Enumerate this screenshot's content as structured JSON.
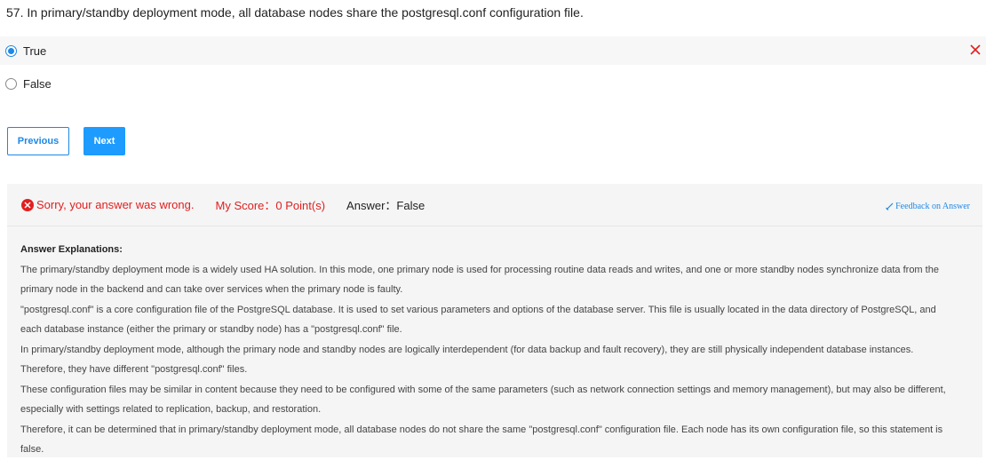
{
  "question": {
    "text": "57. In primary/standby deployment mode, all database nodes share the postgresql.conf configuration file."
  },
  "options": [
    {
      "label": "True",
      "selected": true
    },
    {
      "label": "False",
      "selected": false
    }
  ],
  "buttons": {
    "previous_label": "Previous",
    "next_label": "Next"
  },
  "result": {
    "sorry_text": "Sorry, your answer was wrong.",
    "score_text": "My Score：0 Point(s)",
    "answer_text": "Answer：False",
    "feedback_label": "Feedback on Answer"
  },
  "explanation": {
    "title": "Answer Explanations:",
    "lines": [
      "The primary/standby deployment mode is a widely used HA solution. In this mode, one primary node is used for processing routine data reads and writes, and one or more standby nodes synchronize data from the",
      "primary node in the backend and can take over services when the primary node is faulty.",
      "\"postgresql.conf\" is a core configuration file of the PostgreSQL database. It is used to set various parameters and options of the database server. This file is usually located in the data directory of PostgreSQL, and",
      "each database instance (either the primary or standby node) has a \"postgresql.conf\" file.",
      "In primary/standby deployment mode, although the primary node and standby nodes are logically interdependent (for data backup and fault recovery), they are still physically independent database instances.",
      "Therefore, they have different \"postgresql.conf\" files.",
      "These configuration files may be similar in content because they need to be configured with some of the same parameters (such as network connection settings and memory management), but may also be different,",
      "especially with settings related to replication, backup, and restoration.",
      "Therefore, it can be determined that in primary/standby deployment mode, all database nodes do not share the same \"postgresql.conf\" configuration file. Each node has its own configuration file, so this statement is",
      "false."
    ]
  },
  "colors": {
    "accent": "#1e88e5",
    "error": "#e02020"
  }
}
